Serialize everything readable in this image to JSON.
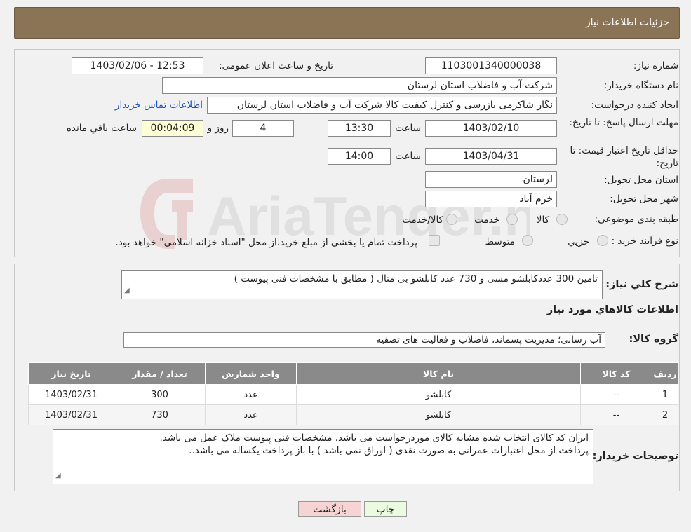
{
  "header": {
    "title": "جزئیات اطلاعات نیاز"
  },
  "need": {
    "number_label": "شماره نیاز:",
    "number_value": "1103001340000038",
    "announce_label": "تاریخ و ساعت اعلان عمومی:",
    "announce_value": "1403/02/06 - 12:53",
    "buyer_label": "نام دستگاه خریدار:",
    "buyer_value": "شرکت آب و فاضلاب استان لرستان",
    "creator_label": "ایجاد کننده درخواست:",
    "creator_value": "نگار شاکرمی بازرسی و کنترل کیفیت کالا شرکت آب و فاضلاب استان لرستان",
    "contact_link": "اطلاعات تماس خریدار",
    "deadline_label": "مهلت ارسال پاسخ: تا تاریخ:",
    "deadline_date": "1403/02/10",
    "time_word": "ساعت",
    "deadline_time": "13:30",
    "days_value": "4",
    "days_word": "روز و",
    "remaining_value": "00:04:09",
    "remaining_word": "ساعت باقي مانده",
    "validity_label": "حداقل تاریخ اعتبار قیمت: تا تاریخ:",
    "validity_date": "1403/04/31",
    "validity_time": "14:00",
    "province_label": "استان محل تحویل:",
    "province_value": "لرستان",
    "city_label": "شهر محل تحویل:",
    "city_value": "خرم آباد",
    "category_label": "طبقه بندی موضوعی:",
    "category_options": [
      "کالا",
      "خدمت",
      "کالا/خدمت"
    ],
    "process_label": "نوع فرآیند خرید :",
    "process_options": [
      "جزيي",
      "متوسط"
    ],
    "process_note": "پرداخت تمام یا بخشی از مبلغ خرید،از محل \"اسناد خزانه اسلامی\" خواهد بود."
  },
  "summary": {
    "label": "شرح کلي نياز:",
    "value": "تامین 300 عددکابلشو مسی و 730 عدد کابلشو بی متال ( مطابق با مشخصات فنی پیوست )"
  },
  "goods": {
    "section_title": "اطلاعات کالاهاي مورد نياز",
    "group_label": "گروه کالا:",
    "group_value": "آب رسانی؛ مدیریت پسماند، فاضلاب و فعالیت های تصفیه",
    "columns": [
      "رديف",
      "کد کالا",
      "نام کالا",
      "واحد شمارش",
      "تعداد / مقدار",
      "تاریخ نیاز"
    ],
    "rows": [
      [
        "1",
        "--",
        "کابلشو",
        "عدد",
        "300",
        "1403/02/31"
      ],
      [
        "2",
        "--",
        "کابلشو",
        "عدد",
        "730",
        "1403/02/31"
      ]
    ]
  },
  "notes": {
    "label": "توضیحات خریدار:",
    "line1": "ایران کد کالای انتخاب شده مشابه کالای موردرخواست می باشد. مشخصات فنی پیوست ملاک عمل می باشد.",
    "line2": "پرداخت از محل اعتبارات عمرانی به صورت نقدی ( اوراق نمی باشد ) با  باز پرداخت یکساله می باشد.."
  },
  "buttons": {
    "print": "چاپ",
    "back": "بازگشت"
  },
  "watermark": {
    "text": "AriaTender.neT"
  },
  "colors": {
    "header": "#8b7355",
    "back_button": "#f6d4d4",
    "print_button": "#eafbe0",
    "link": "#1a4fb5"
  }
}
